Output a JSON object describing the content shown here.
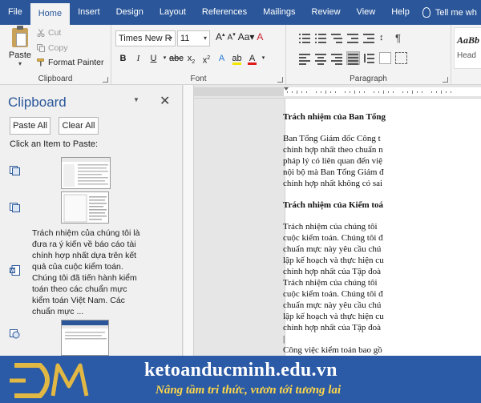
{
  "tabs": [
    "File",
    "Home",
    "Insert",
    "Design",
    "Layout",
    "References",
    "Mailings",
    "Review",
    "View",
    "Help"
  ],
  "tell_me": "Tell me wh",
  "ribbon": {
    "clipboard": {
      "paste": "Paste",
      "cut": "Cut",
      "copy": "Copy",
      "format_painter": "Format Painter",
      "label": "Clipboard"
    },
    "font": {
      "name": "Times New R",
      "size": "11",
      "label": "Font",
      "colors": {
        "highlight": "#f2e600",
        "font_color": "#e21b1b"
      }
    },
    "paragraph": {
      "label": "Paragraph"
    },
    "styles": {
      "sample": "AaBb",
      "name": "Head"
    }
  },
  "pane": {
    "title": "Clipboard",
    "paste_all": "Paste All",
    "clear_all": "Clear All",
    "hint": "Click an Item to Paste:",
    "text_item": [
      "Trách nhiệm của chúng tôi là",
      "đưa ra ý kiến về báo cáo tài",
      "chính hợp nhất dựa trên kết",
      "quả của cuộc kiểm toán.",
      "Chúng tôi đã tiến hành kiểm",
      "toán theo các chuẩn mực",
      "kiểm toán Việt Nam. Các",
      "chuẩn mực ..."
    ]
  },
  "document": [
    {
      "type": "heading",
      "text": "Trách nhiệm của Ban Tổng"
    },
    {
      "type": "gap"
    },
    {
      "type": "text",
      "text": "Ban Tổng Giám đốc Công t"
    },
    {
      "type": "text",
      "text": "chính hợp nhất theo chuẩn n"
    },
    {
      "type": "text",
      "text": "pháp lý có liên quan đến việ"
    },
    {
      "type": "text",
      "text": "nội bộ mà Ban Tổng Giám đ"
    },
    {
      "type": "text",
      "text": "chính hợp nhất không có sai"
    },
    {
      "type": "gap"
    },
    {
      "type": "heading",
      "text": "Trách nhiệm của Kiểm toá"
    },
    {
      "type": "gap"
    },
    {
      "type": "text",
      "text": "Trách nhiệm của chúng tôi"
    },
    {
      "type": "text",
      "text": "cuộc kiểm toán. Chúng tôi đ"
    },
    {
      "type": "text",
      "text": "chuẩn mực này yêu cầu chú"
    },
    {
      "type": "text",
      "text": "lập kế hoạch và thực hiện cu"
    },
    {
      "type": "text",
      "text": "chính hợp nhất của Tập đoà"
    },
    {
      "type": "text",
      "text": "Trách nhiệm của chúng tôi"
    },
    {
      "type": "text",
      "text": "cuộc kiểm toán. Chúng tôi đ"
    },
    {
      "type": "text",
      "text": "chuẩn mực này yêu cầu chú"
    },
    {
      "type": "text",
      "text": "lập kế hoạch và thực hiện cu"
    },
    {
      "type": "text",
      "text": "chính hợp nhất của Tập đoà"
    },
    {
      "type": "text",
      "text": "|"
    },
    {
      "type": "text",
      "text": "Công việc kiểm toán bao gồ"
    }
  ],
  "banner": {
    "site": "ketoanducminh.edu.vn",
    "slogan": "Nâng tầm tri thức, vươn tới tương lai",
    "logo": "ĐM"
  },
  "colors": {
    "accent": "#2b579a",
    "banner": "#2b5aa6",
    "logo_gold": "#e2b845",
    "slogan": "#ffd84a"
  }
}
